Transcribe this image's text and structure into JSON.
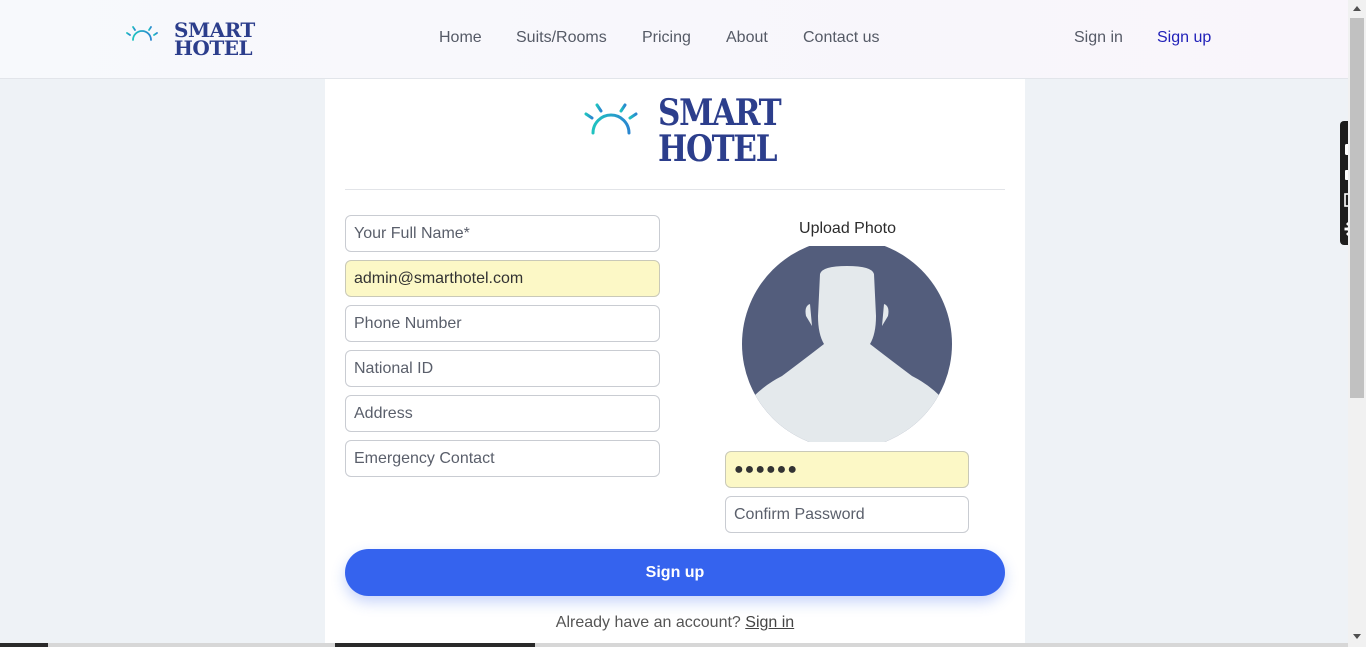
{
  "brand": {
    "name_line1": "SMART",
    "name_line2": "HOTEL",
    "logo_icon": "sunrise-icon",
    "colors": {
      "teal": "#1fc3c0",
      "navy": "#2c3e8c"
    }
  },
  "nav": {
    "links": [
      "Home",
      "Suits/Rooms",
      "Pricing",
      "About",
      "Contact us"
    ],
    "sign_in": "Sign in",
    "sign_up": "Sign up"
  },
  "form": {
    "full_name_placeholder": "Your Full Name*",
    "email_value": "admin@smarthotel.com",
    "phone_placeholder": "Phone Number",
    "national_id_placeholder": "National ID",
    "address_placeholder": "Address",
    "emergency_placeholder": "Emergency Contact",
    "upload_label": "Upload Photo",
    "avatar_icon": "default-avatar-icon",
    "password_value": "●●●●●●",
    "confirm_password_placeholder": "Confirm Password",
    "submit_label": "Sign up",
    "already_text": "Already have an account?",
    "signin_link": "Sign in"
  },
  "side_toolbar": {
    "icons": [
      "camera-icon",
      "video-icon",
      "screens-icon",
      "gear-icon"
    ]
  },
  "colors": {
    "accent": "#3563ee",
    "autofill": "#fcf8c6",
    "signup_link": "#1f1fb8"
  }
}
